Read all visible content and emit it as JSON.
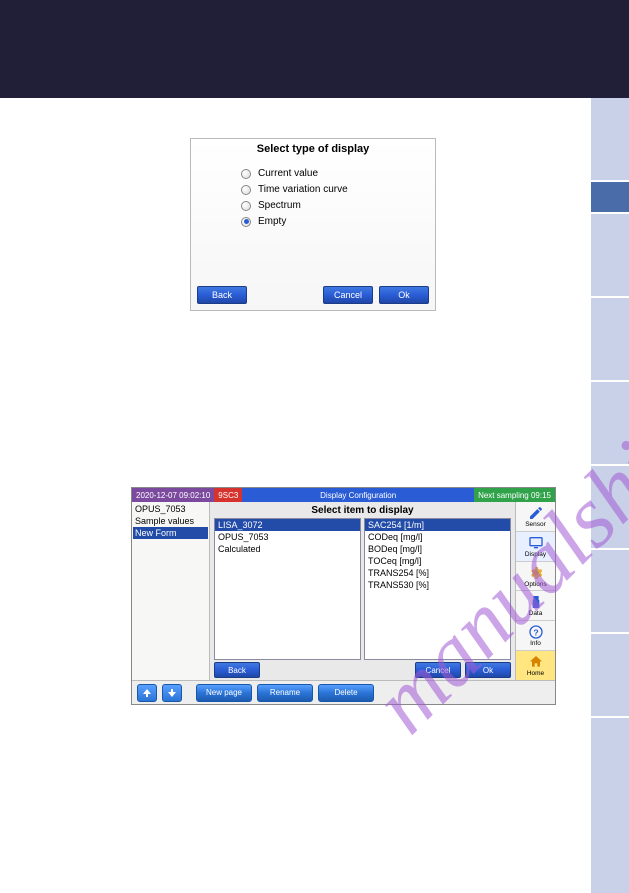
{
  "watermark": "manualshive.com",
  "dialog1": {
    "title": "Select type of display",
    "options": [
      {
        "label": "Current value",
        "selected": false
      },
      {
        "label": "Time variation curve",
        "selected": false
      },
      {
        "label": "Spectrum",
        "selected": false
      },
      {
        "label": "Empty",
        "selected": true
      }
    ],
    "buttons": {
      "back": "Back",
      "cancel": "Cancel",
      "ok": "Ok"
    }
  },
  "screen2": {
    "status": {
      "datetime": "2020-12-07 09:02:10",
      "code": "9SC3",
      "title": "Display Configuration",
      "next": "Next sampling 09:15"
    },
    "tree": {
      "items": [
        "OPUS_7053",
        "Sample values",
        "New Form"
      ],
      "selected_index": 2
    },
    "selector": {
      "title": "Select item to display",
      "left_items": [
        "LISA_3072",
        "OPUS_7053",
        "Calculated"
      ],
      "left_selected_index": 0,
      "right_items": [
        "SAC254 [1/m]",
        "CODeq [mg/l]",
        "BODeq [mg/l]",
        "TOCeq [mg/l]",
        "TRANS254 [%]",
        "TRANS530 [%]"
      ],
      "right_selected_index": 0,
      "buttons": {
        "back": "Back",
        "cancel": "Cancel",
        "ok": "Ok"
      }
    },
    "bottom_buttons": {
      "new_page": "New page",
      "rename": "Rename",
      "delete": "Delete"
    },
    "sidebar": [
      {
        "label": "Sensor",
        "icon": "pencil"
      },
      {
        "label": "Display",
        "icon": "monitor"
      },
      {
        "label": "Options",
        "icon": "gear"
      },
      {
        "label": "Data",
        "icon": "usb"
      },
      {
        "label": "Info",
        "icon": "question"
      },
      {
        "label": "Home",
        "icon": "home"
      }
    ]
  }
}
